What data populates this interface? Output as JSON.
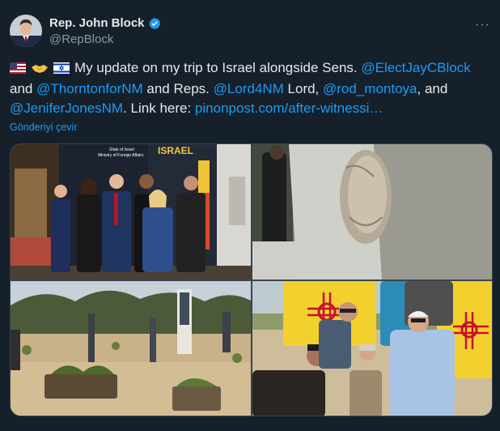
{
  "author": {
    "name": "Rep. John Block",
    "handle": "@RepBlock",
    "verified_icon": "verified-badge-icon"
  },
  "menu": {
    "more_label": "···"
  },
  "post": {
    "flags": [
      "us-flag-icon",
      "handshake-icon",
      "israel-flag-icon"
    ],
    "text_before": "My update on my trip to Israel alongside Sens. ",
    "mention1": "@ElectJayCBlock",
    "text_and1": " and ",
    "mention2": "@ThorntonforNM",
    "text_reps": " and Reps. ",
    "mention3": "@Lord4NM",
    "text_lord": " Lord, ",
    "mention4": "@rod_montoya",
    "text_and2": ", and ",
    "mention5": "@JeniferJonesNM",
    "text_link_here": ". Link here: ",
    "link": "pinonpost.com/after-witnessi…"
  },
  "translate_label": "Gönderiyi çevir",
  "media": {
    "photo1_sign_title": "State of Israel",
    "photo1_sign_sub": "Ministry of Foreign Affairs",
    "photo1_letters": "ISRAEL"
  },
  "colors": {
    "background": "#15202b",
    "link": "#1d9bf0",
    "text": "#e7e9ea",
    "muted": "#8b98a5"
  }
}
